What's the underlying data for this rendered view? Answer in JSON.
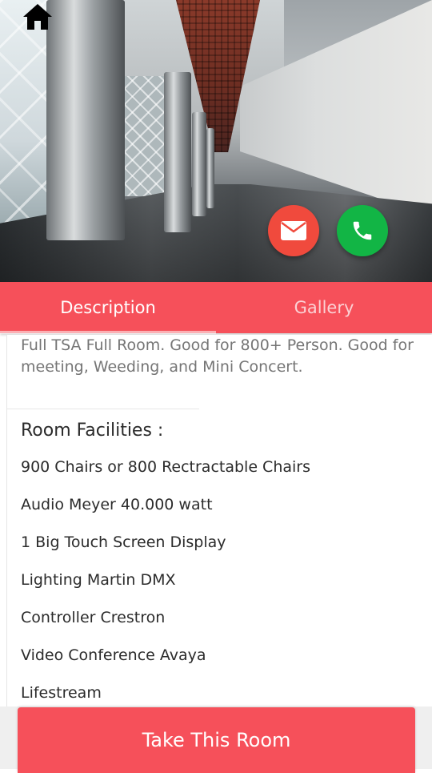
{
  "hero": {
    "home_icon": "home-icon",
    "email_icon": "mail-icon",
    "call_icon": "phone-icon"
  },
  "tabs": [
    {
      "label": "Description",
      "active": true
    },
    {
      "label": "Gallery",
      "active": false
    }
  ],
  "description": {
    "text": "Full TSA Full Room. Good for 800+ Person. Good for meeting, Weeding, and Mini Concert."
  },
  "facilities": {
    "title": "Room Facilities :",
    "items": [
      "900 Chairs or 800 Rectractable Chairs",
      "Audio Meyer 40.000 watt",
      "1 Big Touch Screen Display",
      "Lighting Martin DMX",
      "Controller Crestron",
      "Video Conference Avaya",
      "Lifestream"
    ]
  },
  "cta": {
    "label": "Take This Room"
  },
  "colors": {
    "accent": "#f6505a",
    "email_button": "#f04a3d",
    "call_button": "#12b545"
  }
}
